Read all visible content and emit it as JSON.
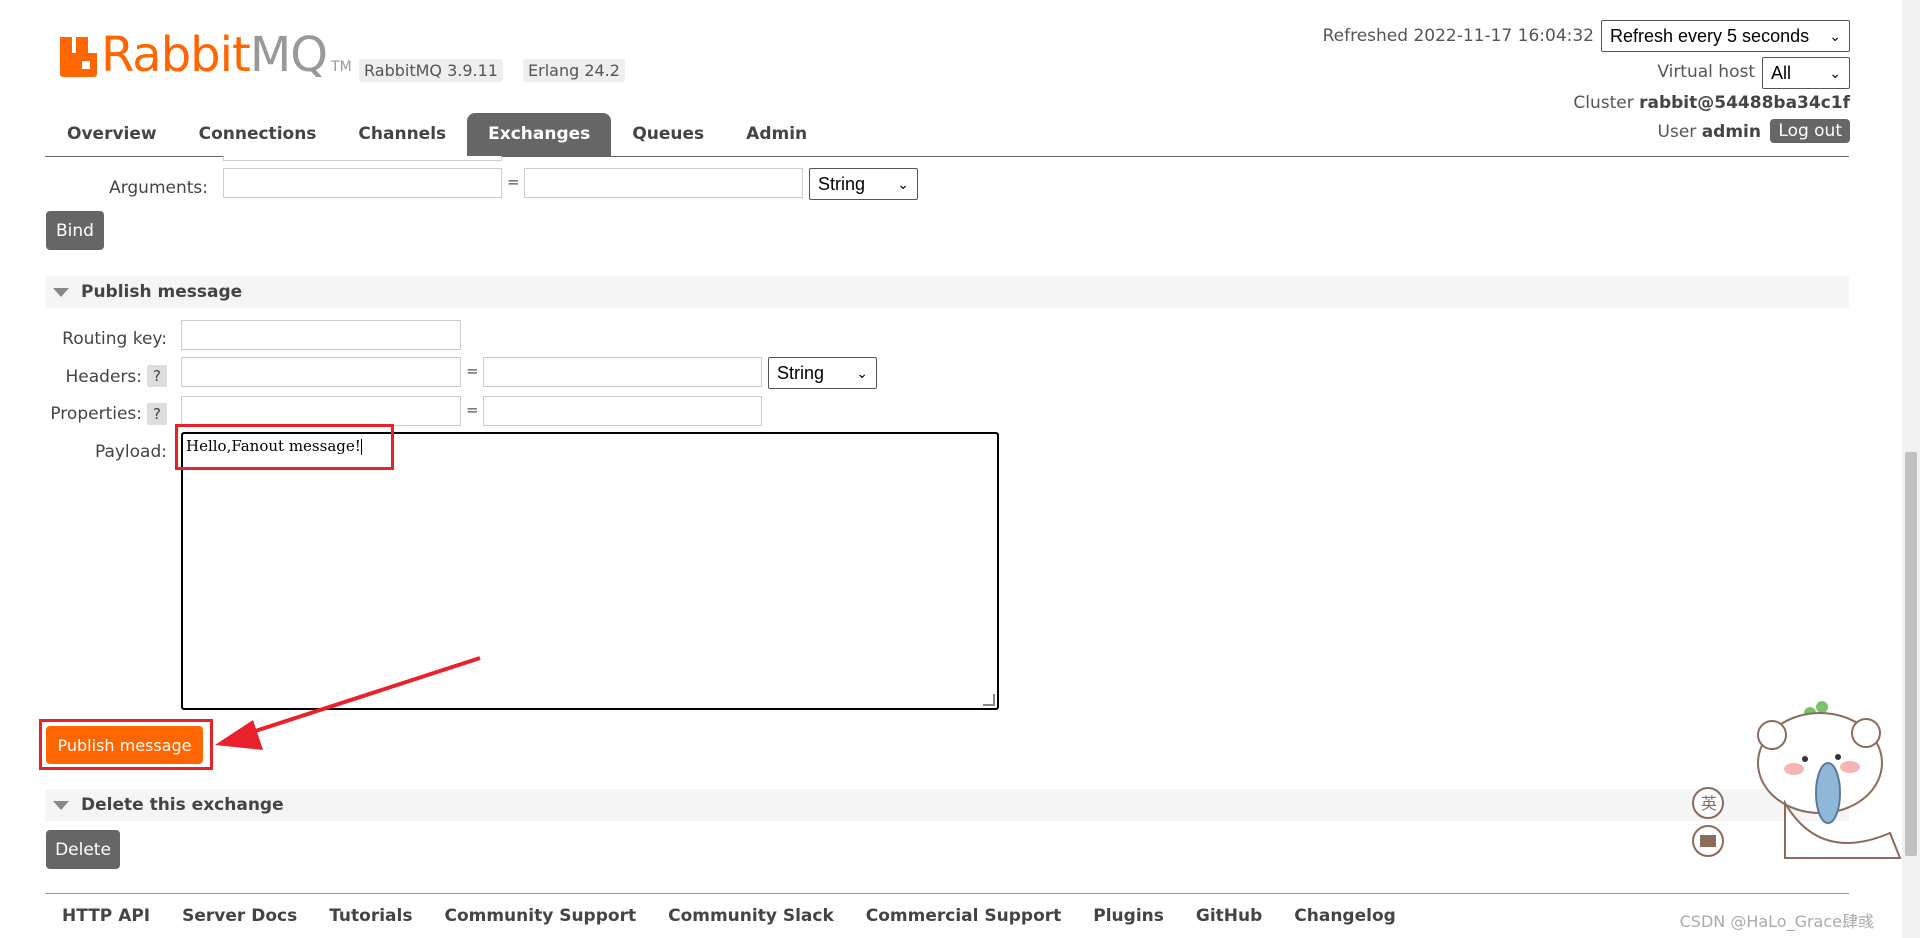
{
  "header": {
    "logo_word_a": "Rabbit",
    "logo_word_b": "MQ",
    "logo_tm": "TM",
    "version": "RabbitMQ 3.9.11",
    "erlang": "Erlang 24.2",
    "refreshed": "Refreshed 2022-11-17 16:04:32",
    "refresh_select": "Refresh every 5 seconds",
    "vhost_label": "Virtual host",
    "vhost_value": "All",
    "cluster_label": "Cluster",
    "cluster_value": "rabbit@54488ba34c1f",
    "user_label": "User",
    "user_value": "admin",
    "logout": "Log out"
  },
  "nav": {
    "tabs": [
      "Overview",
      "Connections",
      "Channels",
      "Exchanges",
      "Queues",
      "Admin"
    ],
    "active": "Exchanges"
  },
  "bind_section": {
    "arguments_label": "Arguments:",
    "type_select": "String",
    "bind_button": "Bind"
  },
  "publish": {
    "title": "Publish message",
    "routing_key_label": "Routing key:",
    "headers_label": "Headers:",
    "properties_label": "Properties:",
    "payload_label": "Payload:",
    "help": "?",
    "eq": "=",
    "headers_type": "String",
    "payload_value": "Hello,Fanout message!",
    "button": "Publish message"
  },
  "delete_section": {
    "title": "Delete this exchange",
    "button": "Delete"
  },
  "footer": {
    "links": [
      "HTTP API",
      "Server Docs",
      "Tutorials",
      "Community Support",
      "Community Slack",
      "Commercial Support",
      "Plugins",
      "GitHub",
      "Changelog"
    ],
    "watermark": "CSDN @HaLo_Grace肆彧"
  },
  "mascot_labels": [
    "英"
  ],
  "colors": {
    "accent": "#ff6600",
    "annotation": "#e8212a",
    "button": "#666666"
  }
}
